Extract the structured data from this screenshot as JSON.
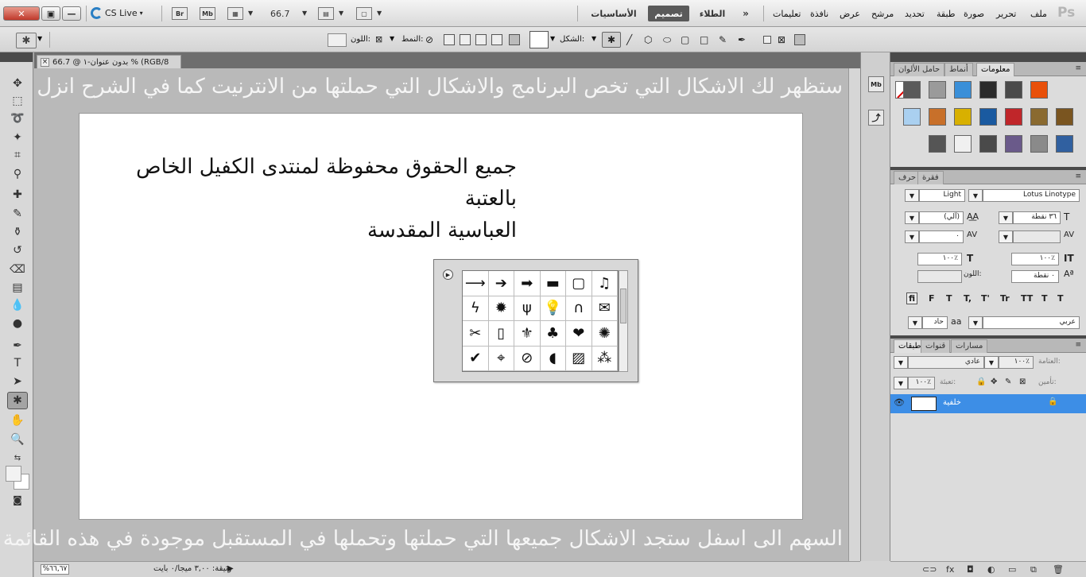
{
  "window": {
    "close_label": "✕",
    "restore_label": "▣",
    "min_label": "—",
    "cs_live": "CS Live",
    "app_logo": "Ps"
  },
  "app_icons": {
    "bridge": "Br",
    "mini_bridge": "Mb"
  },
  "zoom": "66.7",
  "workspaces": {
    "essentials": "الأساسيات",
    "design": "تصميم",
    "highlights": "الطلاء",
    "more": "»"
  },
  "menu": [
    "ملف",
    "تحرير",
    "صورة",
    "طبقة",
    "تحديد",
    "مرشح",
    "عرض",
    "نافذة",
    "تعليمات"
  ],
  "options": {
    "color_label": "اللون:",
    "style_label": "النمط:",
    "shape_label": "الشكل:"
  },
  "document": {
    "tab_title": "بدون عنوان-١ @ 66.7 % (RGB/8",
    "tab_close": "×",
    "top_note": "ستظهر لك الاشكال التي تخص البرنامج والاشكال التي حملتها من الانترنيت كما في الشرح انزل",
    "bottom_note": "السهم الى اسفل ستجد الاشكال جميعها التي حملتها وتحملها في المستقبل موجودة في هذه القائمة",
    "canvas_text_line1": "جميع الحقوق محفوظة لمنتدى الكفيل الخاص بالعتبة",
    "canvas_text_line2": "العباسية المقدسة"
  },
  "status": {
    "zoom": "%٦٦,٦٧",
    "doc_info": "وثيقة: ٣,٠٠ ميجا/٠ بايت"
  },
  "shape_picker": {
    "shapes": [
      "arrow-thin",
      "arrow-bold",
      "arrow-solid",
      "banner",
      "frame",
      "music-note",
      "lightning",
      "starburst",
      "grass",
      "light-bulb",
      "horse-shoe",
      "envelope",
      "scissors",
      "blank-frame",
      "fleur-de-lis",
      "paw",
      "heart",
      "blob",
      "checkmark",
      "target",
      "no-sign",
      "speech-bubble",
      "hatch",
      "checker"
    ],
    "glyphs": [
      "⟶",
      "➔",
      "➡",
      "▬",
      "▢",
      "♫",
      "ϟ",
      "✹",
      "ψ",
      "💡",
      "∩",
      "✉",
      "✂",
      "▯",
      "⚜",
      "♣",
      "❤",
      "✺",
      "✔",
      "⌖",
      "⊘",
      "◖",
      "▨",
      "⁂"
    ]
  },
  "panels": {
    "styles_tabs": [
      "معلومات",
      "أنماط",
      "حامل الألوان"
    ],
    "char_tabs": [
      "فقرة",
      "حرف"
    ],
    "font_family": "Lotus Linotype",
    "font_style": "Light",
    "font_size": "٣٦ نقطة",
    "leading": "(آلي)",
    "kerning": "",
    "tracking": "٠",
    "vscale": "١٠٠٪",
    "hscale": "١٠٠٪",
    "baseline": "٠ نقطة",
    "color_label": "اللون:",
    "language": "عربي",
    "aa_method": "حاد",
    "aa_label": "aa",
    "text_buttons": [
      "T",
      "T",
      "TT",
      "Tr",
      "T'",
      "T,",
      "T",
      "F",
      "fi"
    ],
    "layers_tabs": [
      "طبقات",
      "قنوات",
      "مسارات"
    ],
    "blend_mode": "عادي",
    "opacity_label": "العتامة:",
    "opacity": "١٠٠٪",
    "lock_label": "تأمين:",
    "fill_label": "تعبئة:",
    "fill": "١٠٠٪",
    "layer_name": "خلفية"
  },
  "styles_colors": [
    "#ffffff",
    "#e8500a",
    "#4a4a4a",
    "#2b2b2b",
    "#3a8fd8",
    "#9a9a9a",
    "#5a5a5a",
    "#7a5520",
    "#8a6a30",
    "#c0262a",
    "#1a5aa0",
    "#d8b000",
    "#c8702a",
    "#aad0f0",
    "#3060a0",
    "#8a8a8a",
    "#6a5a8a",
    "#4a4a4a",
    "#f0f0f0",
    "#555555"
  ]
}
